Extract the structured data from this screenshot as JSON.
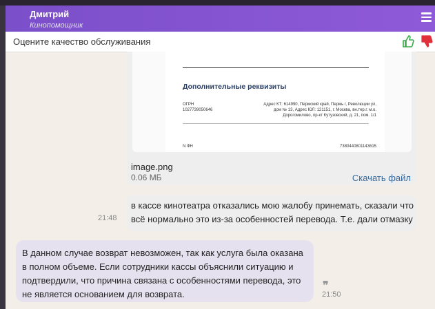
{
  "header": {
    "agent_name": "Дмитрий",
    "agent_role": "Кинопомощник",
    "menu_icon": "hamburger-menu-icon"
  },
  "rating": {
    "prompt": "Оцените качество обслуживания",
    "like_icon": "thumbs-up-icon",
    "dislike_icon": "thumbs-down-icon",
    "like_color": "#3aaa4a",
    "dislike_color": "#e0303a"
  },
  "messages": [
    {
      "type": "file",
      "document": {
        "heading": "Дополнительные реквизиты",
        "ogrn_label": "ОГРН",
        "ogrn_value": "1027739050646",
        "address_line1": "Адрес КТ: 614990, Пермский край, Пермь г, Революции ул,",
        "address_line2": "дом № 13, Адрес ЮЛ: 121151, г. Москва, вн.тер.г. м.о.",
        "address_line3": "Дорогомилово, пр-кт Кутузовский, д. 21, пом. 1/1",
        "fn_label": "N ФН",
        "fn_value": "7380440801143615"
      },
      "file_name": "image.png",
      "file_size": "0.06 МБ",
      "download_label": "Скачать файл"
    },
    {
      "type": "outgoing",
      "time": "21:48",
      "text": "в кассе кинотеатра отказались мою жалобу принемать, сказали что всё нормально это из-за особенностей перевода. Т.е. дали отмазку"
    },
    {
      "type": "incoming",
      "time": "21:50",
      "quote_icon": "quote-icon",
      "text": "В данном случае возврат невозможен, так как услуга была оказана в полном объеме. Если сотрудники кассы объяснили ситуацию и подтвердили, что причина связана с особенностями перевода, это не является основанием для возврата."
    }
  ],
  "colors": {
    "header": "#7b4fc9",
    "incoming_bubble": "#e6e1ee",
    "outgoing_bubble": "#eeeeee",
    "background": "#f3eee8",
    "link": "#3a6a9a"
  }
}
